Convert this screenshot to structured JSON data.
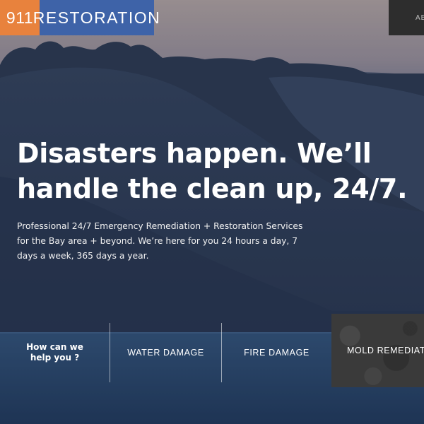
{
  "logo": {
    "number": "911",
    "word": "RESTORATION"
  },
  "nav": {
    "partial_label": "AB"
  },
  "hero": {
    "title_lines": [
      "Disasters happen. We’ll",
      "handle the clean up, 24/7."
    ],
    "subtitle_lines": [
      "Professional 24/7 Emergency Remediation + Restoration Services",
      "for the Bay area + beyond.  We’re here for you 24 hours a day, 7",
      "days a week, 365 days a year."
    ]
  },
  "services": {
    "prompt_lines": [
      "How can we",
      "help you ?"
    ],
    "items": [
      "WATER DAMAGE",
      "FIRE DAMAGE",
      "MOLD REMEDIATION"
    ]
  },
  "colors": {
    "logo_number_bg": "#e8823d",
    "logo_word_bg": "#3e63a8",
    "sky_top": "#b8a9a4",
    "hills": "#2b3b58",
    "ocean": "#2c4e78"
  }
}
